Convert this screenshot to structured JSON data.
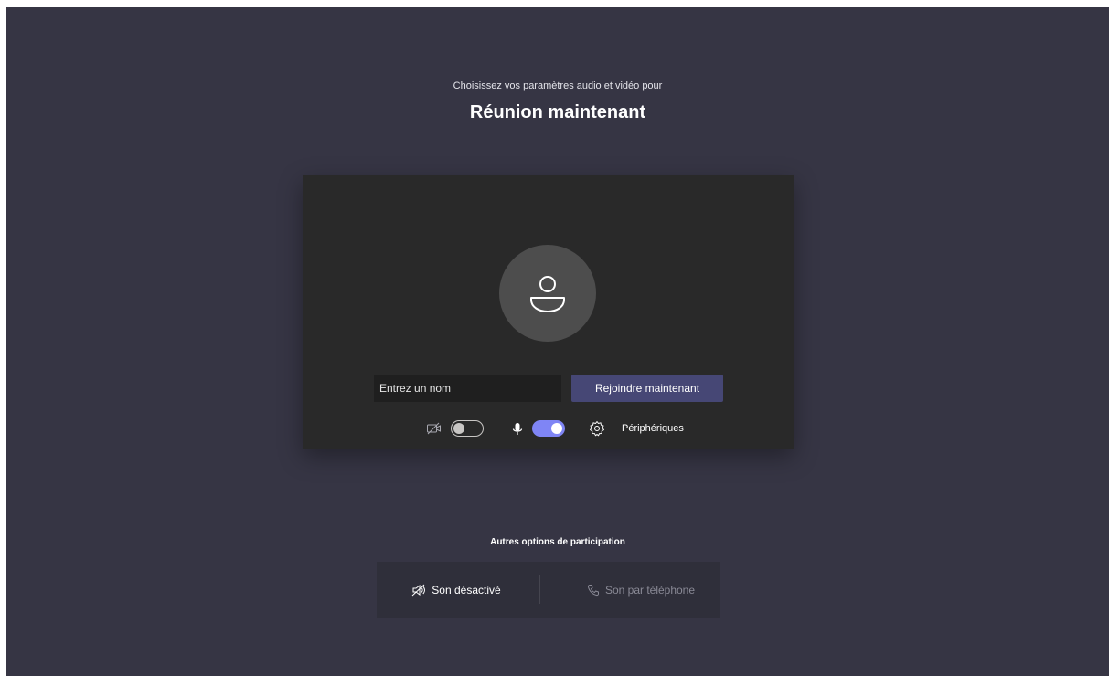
{
  "header": {
    "subtitle": "Choisissez vos paramètres audio et vidéo pour",
    "title": "Réunion maintenant"
  },
  "prejoin": {
    "name_placeholder": "Entrez un nom",
    "join_label": "Rejoindre maintenant",
    "camera": {
      "icon": "camera-off-icon",
      "enabled": false
    },
    "microphone": {
      "icon": "microphone-icon",
      "enabled": true
    },
    "devices": {
      "icon": "gear-icon",
      "label": "Périphériques"
    }
  },
  "other_options": {
    "title": "Autres options de participation",
    "audio_off": {
      "icon": "speaker-off-icon",
      "label": "Son désactivé"
    },
    "phone_audio": {
      "icon": "phone-icon",
      "label": "Son par téléphone"
    }
  },
  "colors": {
    "background": "#363544",
    "card": "#292929",
    "accent_button": "#464775",
    "toggle_on": "#7f85f5"
  }
}
